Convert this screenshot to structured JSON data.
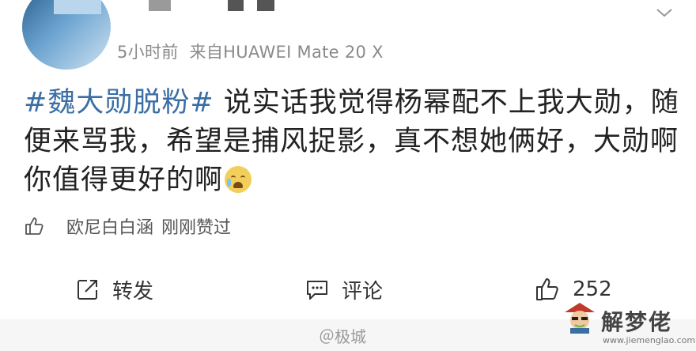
{
  "post": {
    "meta": {
      "time": "5小时前",
      "source": "来自HUAWEI Mate 20 X"
    },
    "content": {
      "hashtag": "#魏大勋脱粉#",
      "text": " 说实话我觉得杨幂配不上我大勋，随便来骂我，希望是捕风捉影，真不想她俩好，大勋啊你值得更好的啊"
    },
    "likes_line": {
      "names": "欧尼白白涵",
      "suffix": "刚刚赞过"
    },
    "actions": {
      "repost_label": "转发",
      "comment_label": "评论",
      "like_count": "252"
    }
  },
  "watermark": {
    "center_text": "＠极城",
    "brand": "解梦佬",
    "url": "www.jiemenglao.com"
  },
  "icons": {
    "chevron": "chevron-down-icon",
    "like_small": "thumbs-up-icon",
    "repost": "repost-icon",
    "comment": "comment-icon",
    "like": "thumbs-up-icon",
    "watermark_logo": "mascot-logo-icon"
  },
  "colors": {
    "hashtag": "#3a6ea5",
    "meta_text": "#8a8a8a",
    "body_text": "#222222"
  }
}
